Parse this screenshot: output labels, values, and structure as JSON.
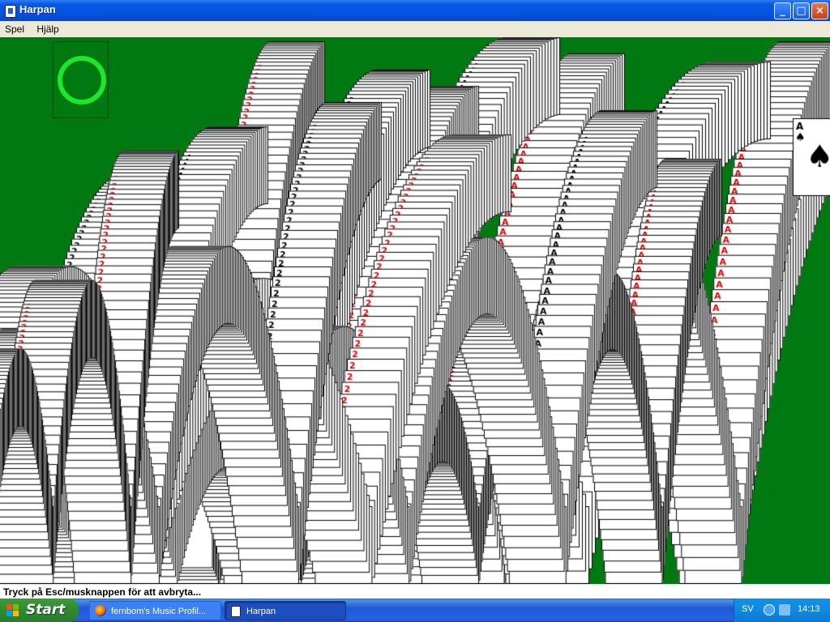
{
  "window": {
    "title": "Harpan",
    "minimize": "_",
    "maximize": "□",
    "close": "×",
    "title_bar_color": "#0554e3"
  },
  "menu": {
    "items": [
      "Spel",
      "Hjälp"
    ]
  },
  "game": {
    "felt_color": "#007a10",
    "deck_marker": "restart-ring-icon",
    "ring_color": "#1ee62a",
    "cascade_colors": {
      "red": "#e00000",
      "black": "#000000",
      "card": "#ffffff"
    },
    "visible_card_ranks": [
      "A",
      "2"
    ],
    "visible_suits": [
      "spades",
      "hearts"
    ]
  },
  "status_bar": {
    "text": "Tryck på Esc/musknappen för att avbryta..."
  },
  "taskbar": {
    "start_label": "Start",
    "tasks": [
      {
        "label": "fernbom's Music Profil...",
        "icon": "firefox-icon",
        "active": false
      },
      {
        "label": "Harpan",
        "icon": "window-icon",
        "active": true
      }
    ],
    "language": "SV",
    "clock": "14:13"
  }
}
